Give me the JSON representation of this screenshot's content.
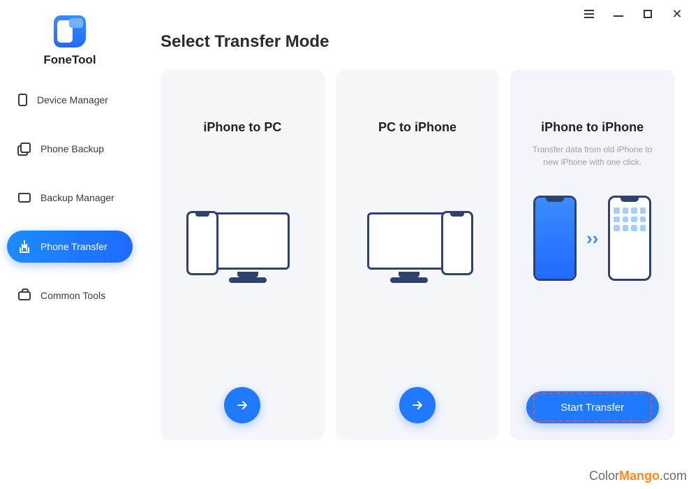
{
  "brand": {
    "name": "FoneTool"
  },
  "titlebar": {
    "menu": "menu",
    "minimize": "minimize",
    "maximize": "maximize",
    "close": "close"
  },
  "sidebar": {
    "items": [
      {
        "label": "Device Manager"
      },
      {
        "label": "Phone Backup"
      },
      {
        "label": "Backup Manager"
      },
      {
        "label": "Phone Transfer"
      },
      {
        "label": "Common Tools"
      }
    ],
    "selected_index": 3
  },
  "page": {
    "title": "Select Transfer Mode"
  },
  "cards": [
    {
      "title": "iPhone to PC",
      "subtitle": "",
      "action": "go"
    },
    {
      "title": "PC to iPhone",
      "subtitle": "",
      "action": "go"
    },
    {
      "title": "iPhone to iPhone",
      "subtitle": "Transfer data from old iPhone to new iPhone with one click.",
      "action_label": "Start Transfer"
    }
  ],
  "watermark": {
    "brand": "Color",
    "brand2": "Mango",
    "suffix": ".com"
  }
}
